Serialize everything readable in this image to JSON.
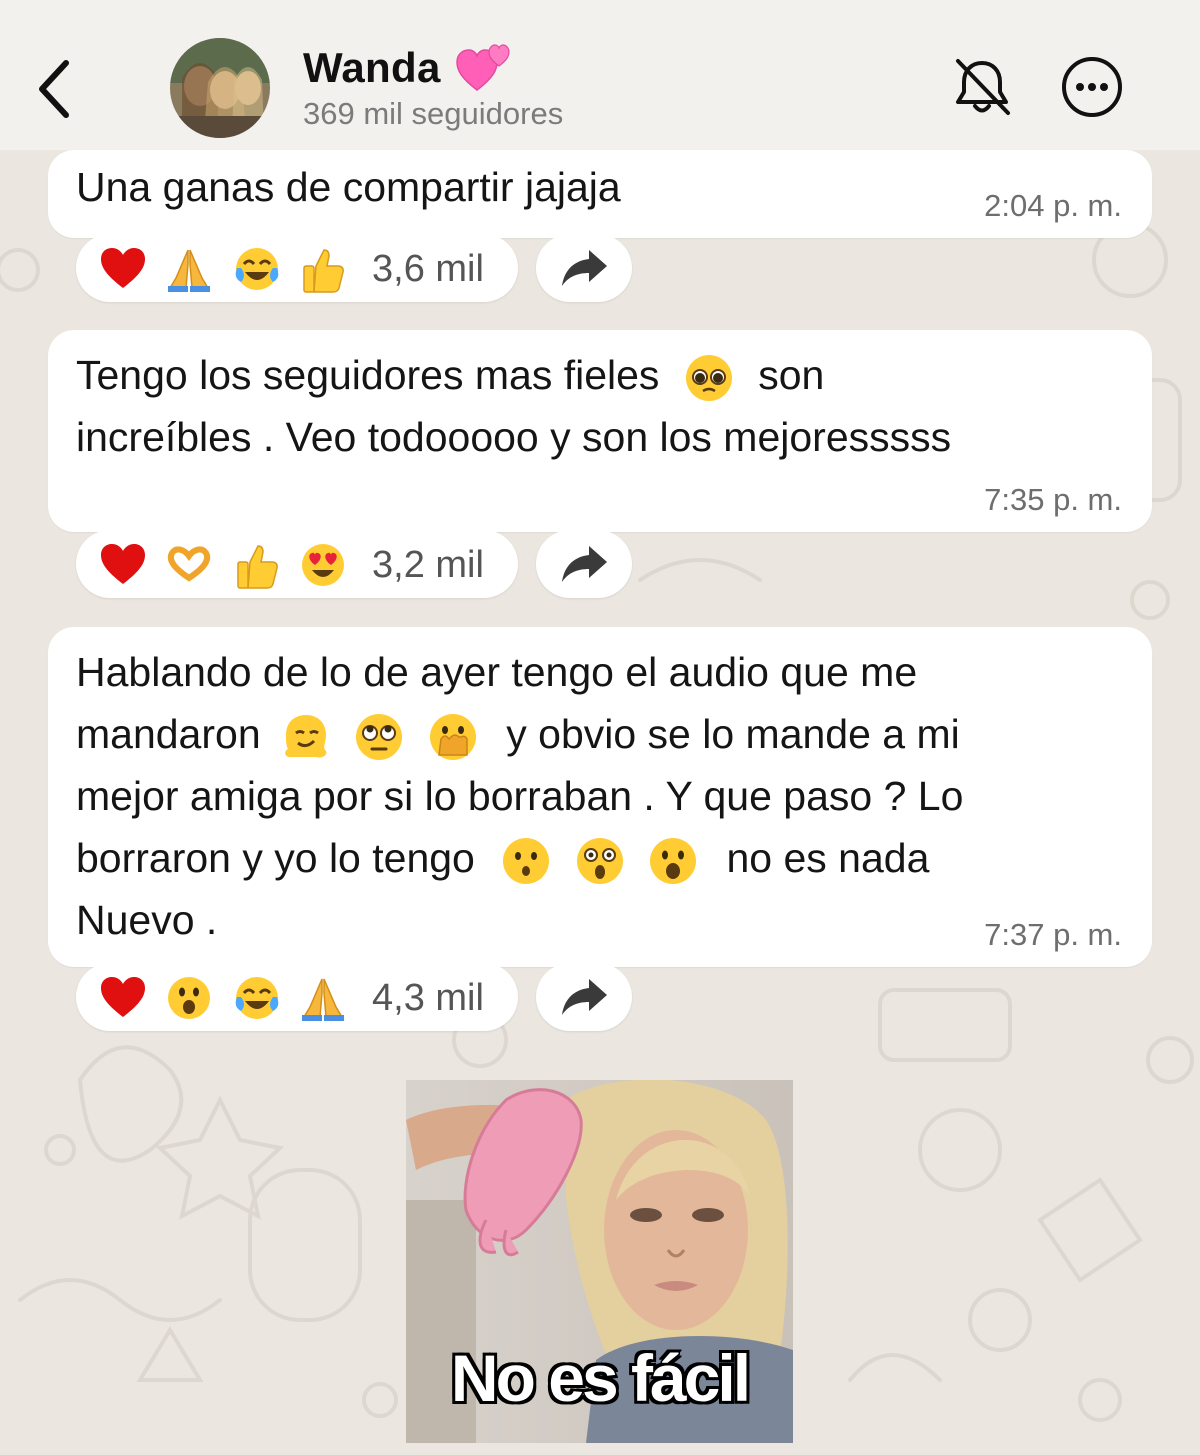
{
  "header": {
    "name": "Wanda",
    "followers": "369 mil seguidores",
    "name_emoji": "two-pink-hearts"
  },
  "messages": [
    {
      "lines": [
        "Una ganas de compartir jajaja"
      ],
      "time": "2:04",
      "time_suffix": "p. m.",
      "reactions": [
        "red-heart",
        "folded-hands",
        "tears-of-joy",
        "thumbs-up"
      ],
      "reaction_count": "3,6 mil"
    },
    {
      "lines": [
        "Tengo los seguidores mas fieles",
        "son",
        "increíbles . Veo todooooo y son los mejoresssss"
      ],
      "inline_emojis": [
        "pleading-face"
      ],
      "time": "7:35",
      "time_suffix": "p. m.",
      "reactions": [
        "red-heart",
        "heart-hands",
        "thumbs-up",
        "heart-eyes"
      ],
      "reaction_count": "3,2 mil"
    },
    {
      "lines": [
        "Hablando de lo de ayer tengo el audio que me",
        "mandaron",
        "y obvio se lo mande a mi",
        "mejor amiga por si lo borraban . Y que paso ? Lo",
        "borraron y yo lo tengo",
        "no es nada",
        "Nuevo ."
      ],
      "inline_emojis": [
        "melting-face",
        "eye-roll",
        "hand-over-mouth",
        "hushed-face",
        "astonished-face",
        "open-mouth-face"
      ],
      "time": "7:37",
      "time_suffix": "p. m.",
      "reactions": [
        "red-heart",
        "open-mouth-face",
        "tears-of-joy",
        "folded-hands"
      ],
      "reaction_count": "4,3 mil"
    }
  ],
  "sticker": {
    "caption": "No es fácil"
  },
  "colors": {
    "background": "#ebe6df",
    "header_bg": "#f3f1ee",
    "bubble_bg": "#ffffff",
    "muted_text": "#6e6e6e"
  }
}
